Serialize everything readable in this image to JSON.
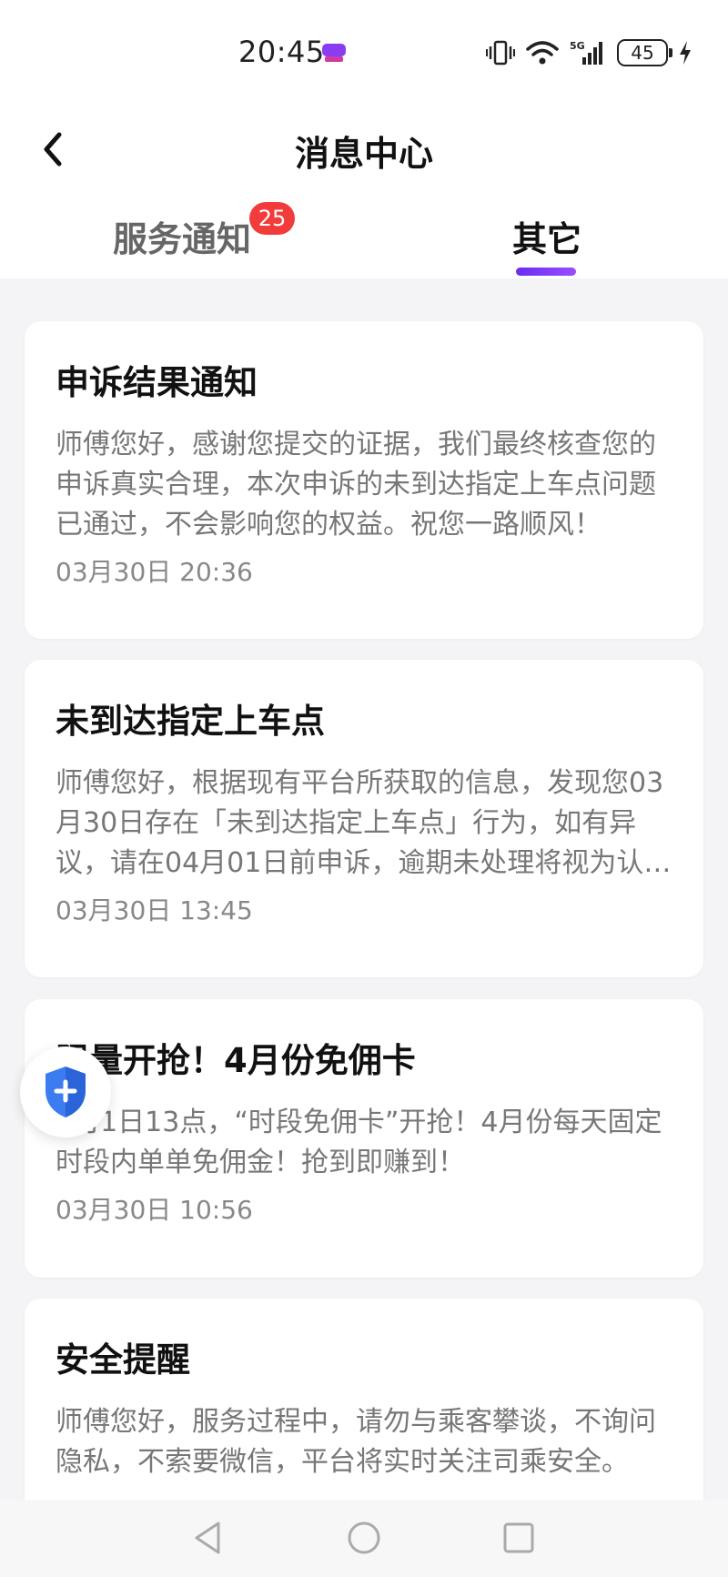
{
  "status_bar": {
    "time": "20:45",
    "battery": "45",
    "network": "5G"
  },
  "header": {
    "title": "消息中心",
    "back_icon": "chevron-left-icon"
  },
  "tabs": [
    {
      "label": "服务通知",
      "badge": "25",
      "active": false
    },
    {
      "label": "其它",
      "active": true
    }
  ],
  "accent_color": "#7b3cf5",
  "badge_color": "#f23b3b",
  "messages": [
    {
      "title": "申诉结果通知",
      "body": "师傅您好，感谢您提交的证据，我们最终核查您的申诉真实合理，本次申诉的未到达指定上车点问题已通过，不会影响您的权益。祝您一路顺风！",
      "time": "03月30日 20:36"
    },
    {
      "title": "未到达指定上车点",
      "body": "师傅您好，根据现有平台所获取的信息，发现您03月30日存在「未到达指定上车点」行为，如有异议，请在04月01日前申诉，逾期未处理将视为认可。",
      "time": "03月30日 13:45"
    },
    {
      "title": "限量开抢！4月份免佣卡",
      "body": "4月1日13点，“时段免佣卡”开抢！4月份每天固定时段内单单免佣金！抢到即赚到！",
      "time": "03月30日 10:56"
    },
    {
      "title": "安全提醒",
      "body": "师傅您好，服务过程中，请勿与乘客攀谈，不询问隐私，不索要微信，平台将实时关注司乘安全。",
      "time": ""
    }
  ],
  "floating_button": {
    "icon": "shield-plus-icon"
  },
  "system_nav": {
    "back_icon": "triangle-back-icon",
    "home_icon": "circle-home-icon",
    "recent_icon": "square-recent-icon"
  }
}
